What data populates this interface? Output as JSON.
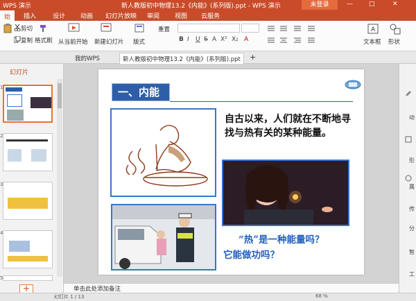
{
  "titlebar": {
    "app_name": "WPS 演示",
    "doc_title": "新人教版初中物理13.2《内能》(系列版).ppt - WPS 演示",
    "login_label": "未登录",
    "minimize": "—",
    "maximize": "□",
    "close": "✕"
  },
  "menubar": {
    "tabs": [
      "始",
      "插入",
      "设计",
      "动画",
      "幻灯片放映",
      "审阅",
      "视图",
      "云服务"
    ]
  },
  "ribbon": {
    "cut": "剪切",
    "copy": "复制",
    "format_painter": "格式刷",
    "from_current": "从当前开始",
    "new_slide": "新建幻灯片",
    "layout": "版式",
    "reset": "重置",
    "textbox": "文本框",
    "shape": "形状",
    "format_chars": [
      "B",
      "I",
      "U",
      "S",
      "A",
      "X²",
      "X₂",
      "A"
    ]
  },
  "doctabs": {
    "wps_tab": "我的WPS",
    "doc_tab": "新人教版初中物理13.2《内能》(系列版).ppt",
    "add": "+"
  },
  "leftpanel": {
    "header": "幻灯片",
    "slide_numbers": [
      "1",
      "2",
      "3",
      "4",
      "5"
    ],
    "add_button": "+"
  },
  "slide": {
    "title": "一、内能",
    "body_text": "自古以来，人们就在不断地寻找与热有关的某种能量。",
    "question_line1": "“热”是一种能量吗？",
    "question_line2": "它能做功吗？"
  },
  "rightpanel": {
    "labels": [
      "动",
      "形",
      "属",
      "传",
      "分",
      "智",
      "工"
    ]
  },
  "notes": {
    "placeholder": "单击此处添加备注"
  },
  "statusbar": {
    "slide_info": "幻灯片 1 / 13",
    "zoom": "68 %"
  },
  "colors": {
    "accent": "#c94b2a",
    "title_blue": "#2e5ea8",
    "question_blue": "#2060c0"
  }
}
